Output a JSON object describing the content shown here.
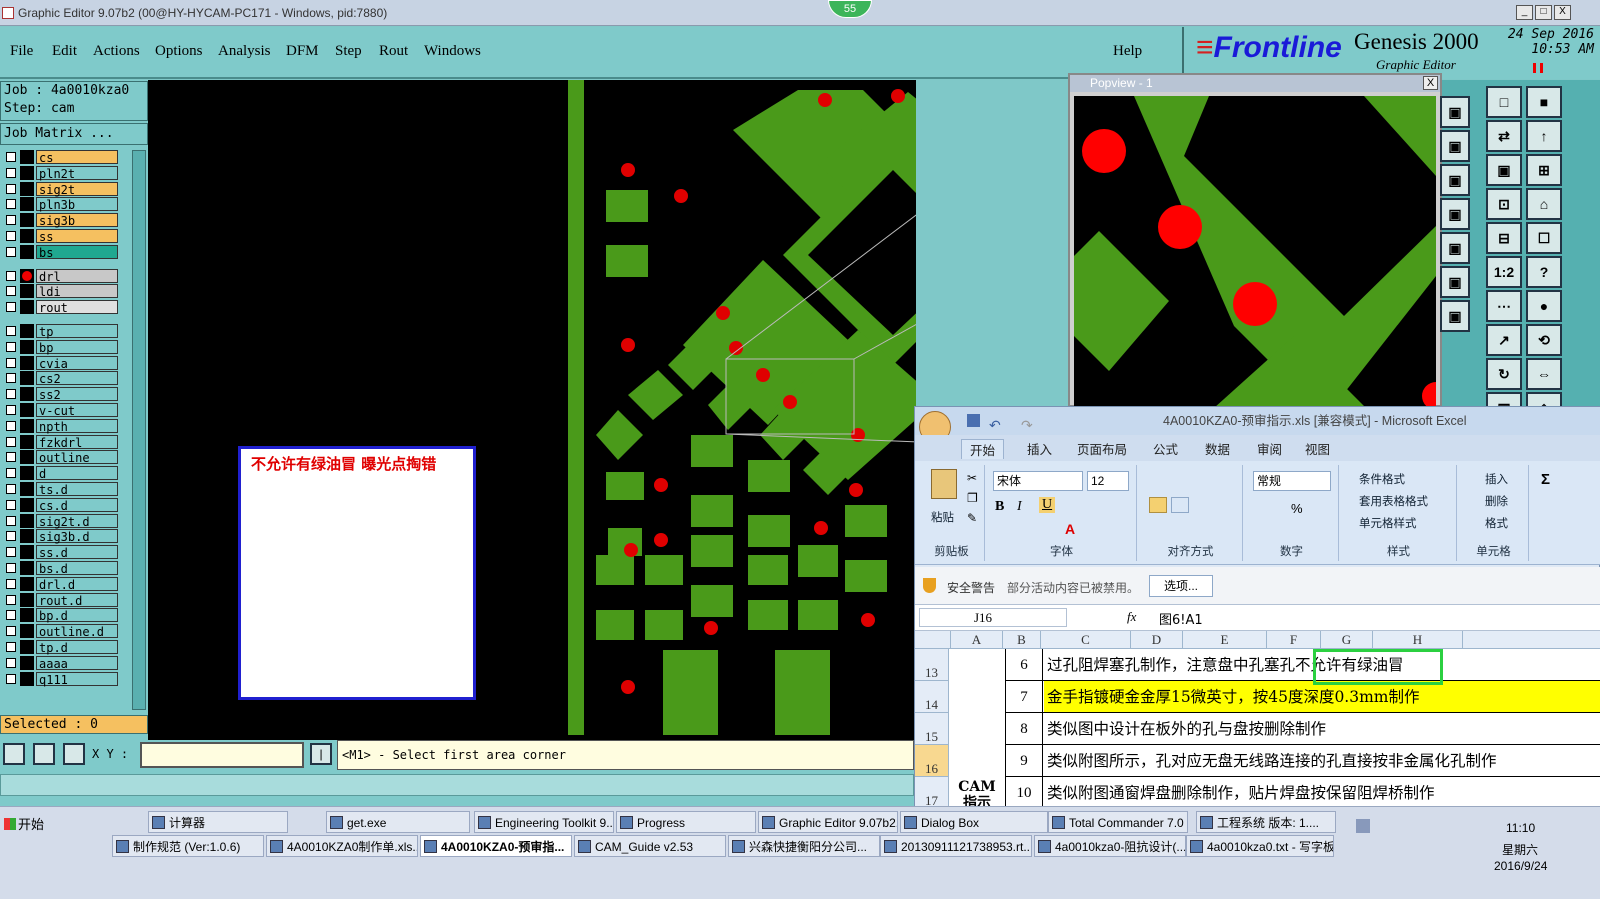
{
  "window": {
    "title": "Graphic Editor 9.07b2 (00@HY-HYCAM-PC171 - Windows, pid:7880)",
    "badge": "55",
    "btn_min": "_",
    "btn_max": "□",
    "btn_close": "X"
  },
  "menu": [
    "File",
    "Edit",
    "Actions",
    "Options",
    "Analysis",
    "DFM",
    "Step",
    "Rout",
    "Windows"
  ],
  "help": "Help",
  "brand": {
    "logo": "Frontline",
    "product": "Genesis 2000",
    "subtitle": "Graphic Editor",
    "date": "24 Sep 2016",
    "time": "10:53 AM"
  },
  "job": {
    "job_label": "Job : 4a0010kza0",
    "step_label": "Step: cam",
    "matrix_button": "Job Matrix ...",
    "selected": "Selected : 0"
  },
  "layers": [
    {
      "name": "cs",
      "color": "#f5c060"
    },
    {
      "name": "pln2t",
      "color": "#7fcaca"
    },
    {
      "name": "sig2t",
      "color": "#f5c060"
    },
    {
      "name": "pln3b",
      "color": "#7fcaca"
    },
    {
      "name": "sig3b",
      "color": "#f5c060"
    },
    {
      "name": "ss",
      "color": "#f5c060"
    },
    {
      "name": "bs",
      "color": "#20a890"
    },
    {
      "name": "drl",
      "color": "#c8c8c8",
      "marker": true
    },
    {
      "name": "ldi",
      "color": "#c8c8c8"
    },
    {
      "name": "rout",
      "color": "#e0e0e0"
    },
    {
      "name": "tp",
      "color": "#7fcaca"
    },
    {
      "name": "bp",
      "color": "#7fcaca"
    },
    {
      "name": "cvia",
      "color": "#7fcaca"
    },
    {
      "name": "cs2",
      "color": "#7fcaca"
    },
    {
      "name": "ss2",
      "color": "#7fcaca"
    },
    {
      "name": "v-cut",
      "color": "#7fcaca"
    },
    {
      "name": "npth",
      "color": "#7fcaca"
    },
    {
      "name": "fzkdrl",
      "color": "#7fcaca"
    },
    {
      "name": "outline",
      "color": "#7fcaca"
    },
    {
      "name": "d",
      "color": "#7fcaca"
    },
    {
      "name": "ts.d",
      "color": "#7fcaca"
    },
    {
      "name": "cs.d",
      "color": "#7fcaca"
    },
    {
      "name": "sig2t.d",
      "color": "#7fcaca"
    },
    {
      "name": "sig3b.d",
      "color": "#7fcaca"
    },
    {
      "name": "ss.d",
      "color": "#7fcaca"
    },
    {
      "name": "bs.d",
      "color": "#7fcaca"
    },
    {
      "name": "drl.d",
      "color": "#7fcaca"
    },
    {
      "name": "rout.d",
      "color": "#7fcaca"
    },
    {
      "name": "bp.d",
      "color": "#7fcaca"
    },
    {
      "name": "outline.d",
      "color": "#7fcaca"
    },
    {
      "name": "tp.d",
      "color": "#7fcaca"
    },
    {
      "name": "aaaa",
      "color": "#7fcaca"
    },
    {
      "name": "q111",
      "color": "#7fcaca"
    }
  ],
  "annotation": "不允许有绿油冒  曝光点掏错",
  "bottom": {
    "xy_label": "X Y :",
    "xy_value": "",
    "status": "<M1> - Select first area corner"
  },
  "popview": {
    "title": "Popview - 1",
    "close": "X"
  },
  "tools": [
    "□",
    "■",
    "⇄",
    "↑",
    "▣",
    "⊞",
    "⊡",
    "⌂",
    "⊟",
    "☐",
    "1:2",
    "?",
    "⋯",
    "●",
    "↗",
    "⟲",
    "↻",
    "⇔",
    "▦",
    "◈"
  ],
  "excel": {
    "title": "4A0010KZA0-预审指示.xls  [兼容模式] - Microsoft Excel",
    "tabs": [
      "开始",
      "插入",
      "页面布局",
      "公式",
      "数据",
      "审阅",
      "视图"
    ],
    "font_name": "宋体",
    "font_size": "12",
    "number_format": "常规",
    "groups": [
      "剪贴板",
      "字体",
      "对齐方式",
      "数字",
      "样式",
      "单元格"
    ],
    "paste": "粘贴",
    "style_items": [
      "条件格式",
      "套用表格格式",
      "单元格样式"
    ],
    "cell_items": [
      "插入",
      "删除",
      "格式"
    ],
    "warning_title": "安全警告",
    "warning_text": "部分活动内容已被禁用。",
    "options_button": "选项...",
    "name_box": "J16",
    "fx": "fx",
    "formula": "图6!A1",
    "columns": [
      "A",
      "B",
      "C",
      "D",
      "E",
      "F",
      "G",
      "H"
    ],
    "row_numbers": [
      "13",
      "14",
      "15",
      "16",
      "17"
    ],
    "cam_label": "CAM\n指示",
    "rows": [
      {
        "num": "6",
        "text": "过孔阻焊塞孔制作，注意盘中孔塞孔不允许有绿油冒",
        "highlight": false
      },
      {
        "num": "7",
        "text": "金手指镀硬金金厚15微英寸，按45度深度0.3mm制作",
        "highlight": true
      },
      {
        "num": "8",
        "text": "类似图中设计在板外的孔与盘按删除制作",
        "highlight": false
      },
      {
        "num": "9",
        "text": "类似附图所示，孔对应无盘无线路连接的孔直接按非金属化孔制作",
        "highlight": false
      },
      {
        "num": "10",
        "text": "类似附图通窗焊盘删除制作，贴片焊盘按保留阻焊桥制作",
        "highlight": false
      }
    ]
  },
  "taskbar": {
    "start": "开始",
    "row1": [
      "计算器",
      "get.exe",
      "Engineering Toolkit 9....",
      "Progress",
      "Graphic Editor 9.07b2...",
      "Dialog Box",
      "Total Commander 7.0 ...",
      "工程系统  版本: 1...."
    ],
    "row2": [
      "制作规范 (Ver:1.0.6)",
      "4A0010KZA0制作单.xls...",
      "4A0010KZA0-预审指...",
      "CAM_Guide v2.53",
      "兴森快捷衡阳分公司...",
      "20130911121738953.rt...",
      "4a0010kza0-阻抗设计(...",
      "4a0010kza0.txt - 写字板"
    ],
    "clock_time": "11:10",
    "clock_day": "星期六",
    "clock_date": "2016/9/24"
  }
}
